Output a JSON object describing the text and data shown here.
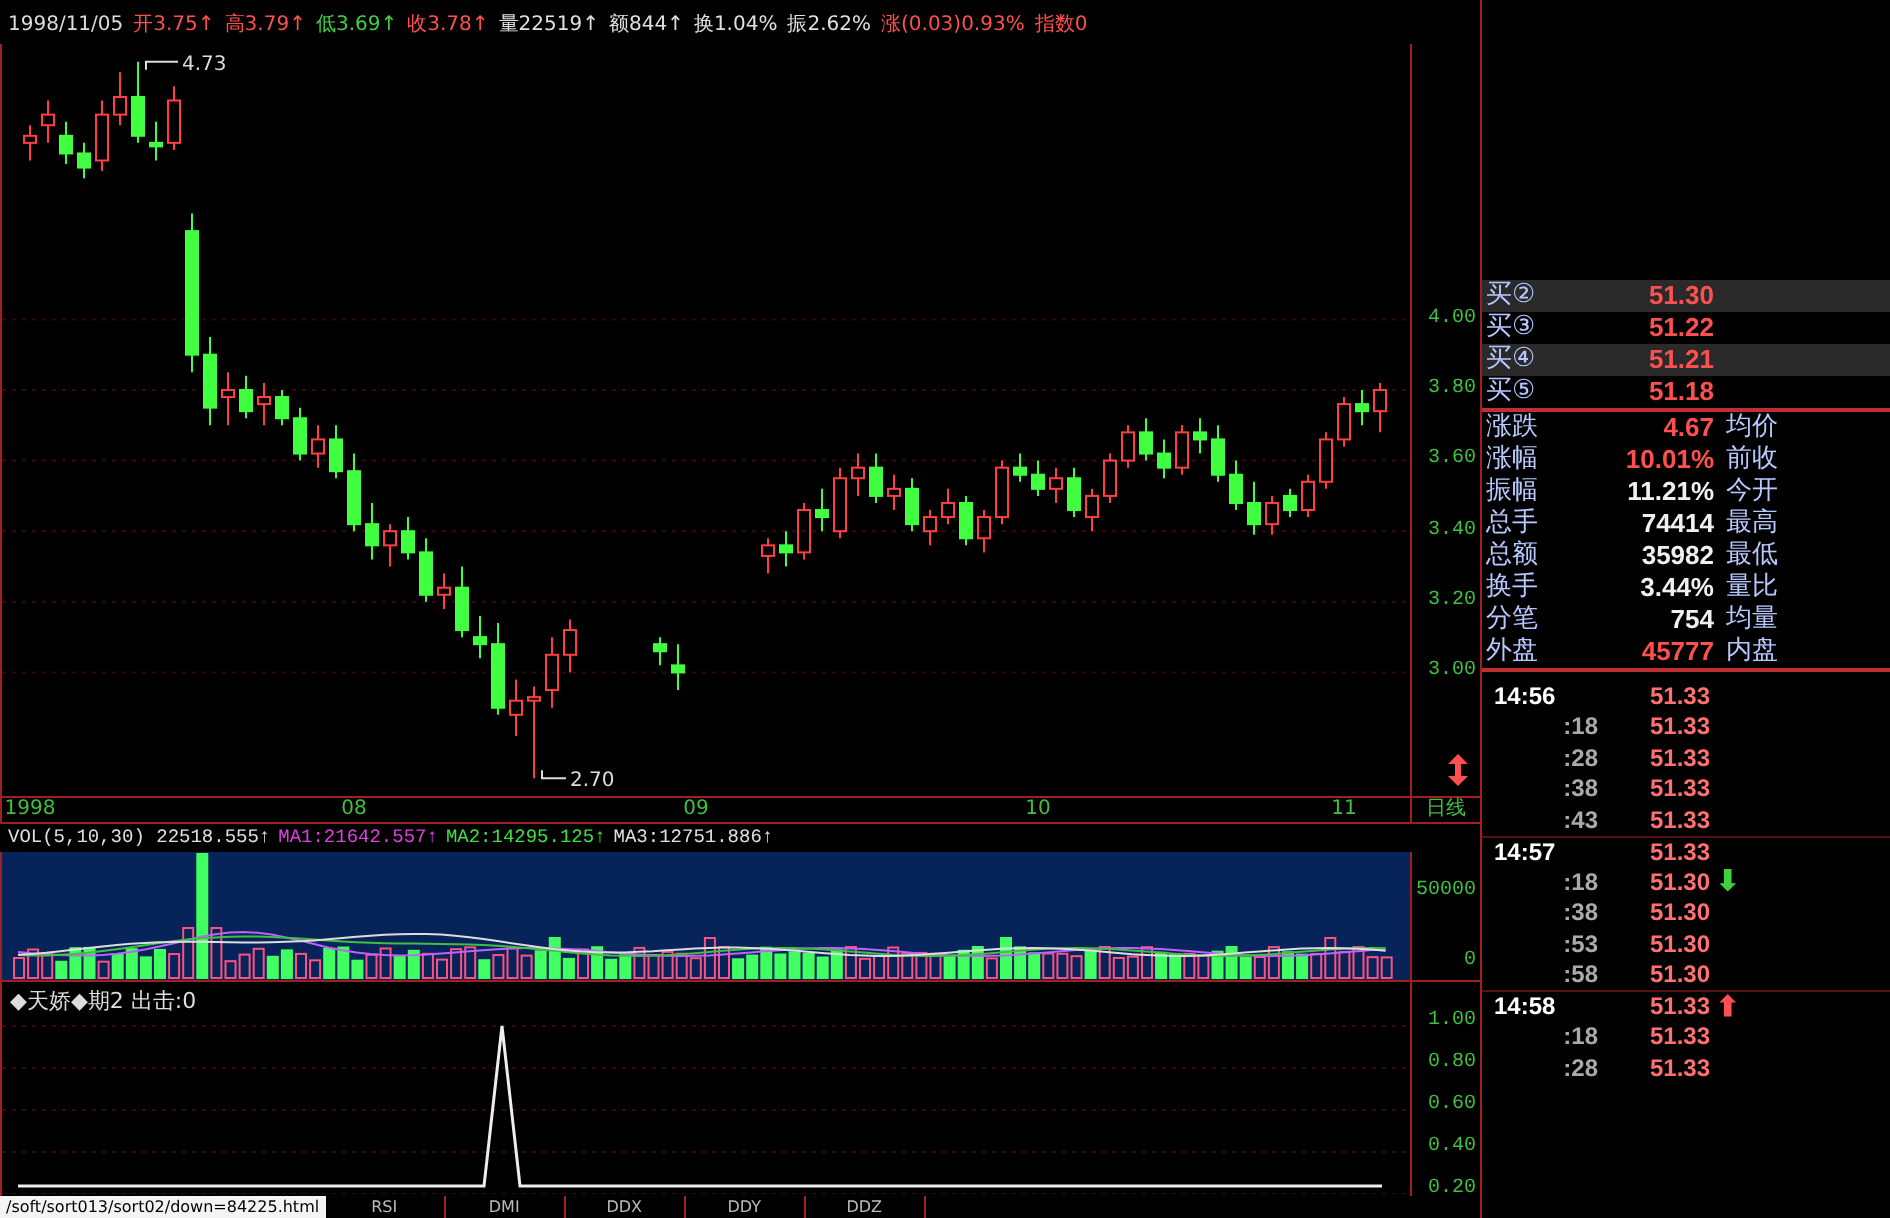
{
  "info_bar": {
    "date": "1998/11/05",
    "fields": [
      {
        "text": "开3.75↑",
        "color": "#ff5050"
      },
      {
        "text": "高3.79↑",
        "color": "#ff5050"
      },
      {
        "text": "低3.69↑",
        "color": "#40d040"
      },
      {
        "text": "收3.78↑",
        "color": "#ff5050"
      },
      {
        "text": "量22519↑",
        "color": "#e0e0e0"
      },
      {
        "text": "额844↑",
        "color": "#e0e0e0"
      },
      {
        "text": "换1.04%",
        "color": "#e0e0e0"
      },
      {
        "text": "振2.62%",
        "color": "#e0e0e0"
      },
      {
        "text": "涨(0.03)0.93%",
        "color": "#ff5050"
      },
      {
        "text": "指数0",
        "color": "#ff5050"
      }
    ]
  },
  "price_chart": {
    "high_label": "4.73",
    "low_label": "2.70",
    "period": "日线",
    "chart_data": {
      "type": "candlestick",
      "categories": [
        "1998",
        null,
        null,
        null,
        null,
        null,
        null,
        null,
        null,
        null,
        null,
        null,
        null,
        null,
        null,
        null,
        null,
        null,
        "08",
        null,
        null,
        null,
        null,
        null,
        null,
        null,
        null,
        null,
        null,
        null,
        null,
        null,
        null,
        null,
        null,
        null,
        null,
        "09",
        null,
        null,
        null,
        null,
        null,
        null,
        null,
        null,
        null,
        null,
        null,
        null,
        null,
        null,
        null,
        null,
        null,
        null,
        "10",
        null,
        null,
        null,
        null,
        null,
        null,
        null,
        null,
        null,
        null,
        null,
        null,
        null,
        null,
        null,
        null,
        "11",
        null,
        null
      ],
      "ylim": [
        2.65,
        4.78
      ],
      "grid": true,
      "yticks": [
        {
          "value": 4,
          "label": "4.00"
        },
        {
          "value": 3.8,
          "label": "3.80"
        },
        {
          "value": 3.6,
          "label": "3.60"
        },
        {
          "value": 3.4,
          "label": "3.40"
        },
        {
          "value": 3.2,
          "label": "3.20"
        },
        {
          "value": 3,
          "label": "3.00"
        }
      ],
      "ohlc": [
        [
          4.5,
          4.55,
          4.45,
          4.52
        ],
        [
          4.55,
          4.62,
          4.5,
          4.58
        ],
        [
          4.52,
          4.56,
          4.44,
          4.47
        ],
        [
          4.47,
          4.5,
          4.4,
          4.43
        ],
        [
          4.45,
          4.62,
          4.42,
          4.58
        ],
        [
          4.58,
          4.7,
          4.55,
          4.63
        ],
        [
          4.63,
          4.73,
          4.5,
          4.52
        ],
        [
          4.5,
          4.56,
          4.45,
          4.49
        ],
        [
          4.5,
          4.66,
          4.48,
          4.62
        ],
        [
          4.25,
          4.3,
          3.85,
          3.9
        ],
        [
          3.9,
          3.95,
          3.7,
          3.75
        ],
        [
          3.78,
          3.85,
          3.7,
          3.8
        ],
        [
          3.8,
          3.84,
          3.72,
          3.74
        ],
        [
          3.76,
          3.82,
          3.7,
          3.78
        ],
        [
          3.78,
          3.8,
          3.7,
          3.72
        ],
        [
          3.72,
          3.75,
          3.6,
          3.62
        ],
        [
          3.62,
          3.7,
          3.58,
          3.66
        ],
        [
          3.66,
          3.7,
          3.55,
          3.57
        ],
        [
          3.57,
          3.62,
          3.4,
          3.42
        ],
        [
          3.42,
          3.48,
          3.32,
          3.36
        ],
        [
          3.36,
          3.42,
          3.3,
          3.4
        ],
        [
          3.4,
          3.44,
          3.32,
          3.34
        ],
        [
          3.34,
          3.38,
          3.2,
          3.22
        ],
        [
          3.22,
          3.28,
          3.18,
          3.24
        ],
        [
          3.24,
          3.3,
          3.1,
          3.12
        ],
        [
          3.1,
          3.16,
          3.04,
          3.08
        ],
        [
          3.08,
          3.14,
          2.88,
          2.9
        ],
        [
          2.88,
          2.98,
          2.82,
          2.92
        ],
        [
          2.92,
          2.96,
          2.7,
          2.93
        ],
        [
          2.95,
          3.1,
          2.9,
          3.05
        ],
        [
          3.05,
          3.15,
          3.0,
          3.12
        ],
        null,
        null,
        null,
        null,
        [
          3.08,
          3.1,
          3.02,
          3.06
        ],
        [
          3.02,
          3.08,
          2.95,
          3.0
        ],
        null,
        null,
        null,
        null,
        [
          3.33,
          3.38,
          3.28,
          3.36
        ],
        [
          3.36,
          3.4,
          3.3,
          3.34
        ],
        [
          3.34,
          3.48,
          3.32,
          3.46
        ],
        [
          3.46,
          3.52,
          3.4,
          3.44
        ],
        [
          3.4,
          3.58,
          3.38,
          3.55
        ],
        [
          3.55,
          3.62,
          3.5,
          3.58
        ],
        [
          3.58,
          3.62,
          3.48,
          3.5
        ],
        [
          3.5,
          3.56,
          3.46,
          3.52
        ],
        [
          3.52,
          3.55,
          3.4,
          3.42
        ],
        [
          3.4,
          3.46,
          3.36,
          3.44
        ],
        [
          3.44,
          3.52,
          3.42,
          3.48
        ],
        [
          3.48,
          3.5,
          3.36,
          3.38
        ],
        [
          3.38,
          3.46,
          3.34,
          3.44
        ],
        [
          3.44,
          3.6,
          3.42,
          3.58
        ],
        [
          3.58,
          3.62,
          3.54,
          3.56
        ],
        [
          3.56,
          3.6,
          3.5,
          3.52
        ],
        [
          3.52,
          3.58,
          3.48,
          3.55
        ],
        [
          3.55,
          3.58,
          3.44,
          3.46
        ],
        [
          3.44,
          3.52,
          3.4,
          3.5
        ],
        [
          3.5,
          3.62,
          3.48,
          3.6
        ],
        [
          3.6,
          3.7,
          3.58,
          3.68
        ],
        [
          3.68,
          3.72,
          3.6,
          3.62
        ],
        [
          3.62,
          3.66,
          3.55,
          3.58
        ],
        [
          3.58,
          3.7,
          3.56,
          3.68
        ],
        [
          3.68,
          3.72,
          3.62,
          3.66
        ],
        [
          3.66,
          3.7,
          3.54,
          3.56
        ],
        [
          3.56,
          3.6,
          3.46,
          3.48
        ],
        [
          3.48,
          3.54,
          3.39,
          3.42
        ],
        [
          3.42,
          3.5,
          3.39,
          3.48
        ],
        [
          3.5,
          3.52,
          3.44,
          3.46
        ],
        [
          3.46,
          3.56,
          3.44,
          3.54
        ],
        [
          3.54,
          3.68,
          3.52,
          3.66
        ],
        [
          3.66,
          3.78,
          3.64,
          3.76
        ],
        [
          3.76,
          3.8,
          3.7,
          3.74
        ],
        [
          3.74,
          3.82,
          3.68,
          3.8
        ]
      ]
    }
  },
  "volume_panel": {
    "legend": [
      {
        "text": "VOL(5,10,30) 22518.555↑",
        "color": "#e0e0e0"
      },
      {
        "text": "MA1:21642.557↑",
        "color": "#e040e0"
      },
      {
        "text": "MA2:14295.125↑",
        "color": "#40e040"
      },
      {
        "text": "MA3:12751.886↑",
        "color": "#e0e0e0"
      }
    ],
    "y_axis": [
      "50000",
      "0"
    ]
  },
  "indicator_panel": {
    "legend": "◆天娇◆期2 出击:0",
    "y_axis": [
      "1.00",
      "0.80",
      "0.60",
      "0.40",
      "0.20"
    ]
  },
  "quote_panel": {
    "bids": [
      {
        "label": "买②",
        "price": "51.30"
      },
      {
        "label": "买③",
        "price": "51.22"
      },
      {
        "label": "买④",
        "price": "51.21"
      },
      {
        "label": "买⑤",
        "price": "51.18"
      }
    ],
    "stats": [
      {
        "label": "涨跌",
        "value": "4.67",
        "color": "#ff5050",
        "right_label": "均价"
      },
      {
        "label": "涨幅",
        "value": "10.01%",
        "color": "#ff5050",
        "right_label": "前收"
      },
      {
        "label": "振幅",
        "value": "11.21%",
        "color": "#f0f0f0",
        "right_label": "今开"
      },
      {
        "label": "总手",
        "value": "74414",
        "color": "#f0f0f0",
        "right_label": "最高"
      },
      {
        "label": "总额",
        "value": "35982",
        "color": "#f0f0f0",
        "right_label": "最低"
      },
      {
        "label": "换手",
        "value": "3.44%",
        "color": "#f0f0f0",
        "right_label": "量比"
      },
      {
        "label": "分笔",
        "value": "754",
        "color": "#f0f0f0",
        "right_label": "均量"
      },
      {
        "label": "外盘",
        "value": "45777",
        "color": "#ff5050",
        "right_label": "内盘"
      }
    ]
  },
  "ticks": [
    {
      "time": "14:56",
      "price": "51.33"
    },
    {
      "time": ":18",
      "price": "51.33"
    },
    {
      "time": ":28",
      "price": "51.33"
    },
    {
      "time": ":38",
      "price": "51.33"
    },
    {
      "time": ":43",
      "price": "51.33"
    },
    {
      "time": "14:57",
      "price": "51.33"
    },
    {
      "time": ":18",
      "price": "51.30",
      "arrow": {
        "text": "⬇",
        "color": "#40d040"
      }
    },
    {
      "time": ":38",
      "price": "51.30"
    },
    {
      "time": ":53",
      "price": "51.30"
    },
    {
      "time": ":58",
      "price": "51.30"
    },
    {
      "time": "14:58",
      "price": "51.33",
      "arrow": {
        "text": "⬆",
        "color": "#ff5050"
      }
    },
    {
      "time": ":18",
      "price": "51.33"
    },
    {
      "time": ":28",
      "price": "51.33"
    }
  ],
  "status_bar": {
    "url": "/soft/sort013/sort02/down=84225.html",
    "tabs": [
      "RSI",
      "DMI",
      "DDX",
      "DDY",
      "DDZ"
    ]
  }
}
